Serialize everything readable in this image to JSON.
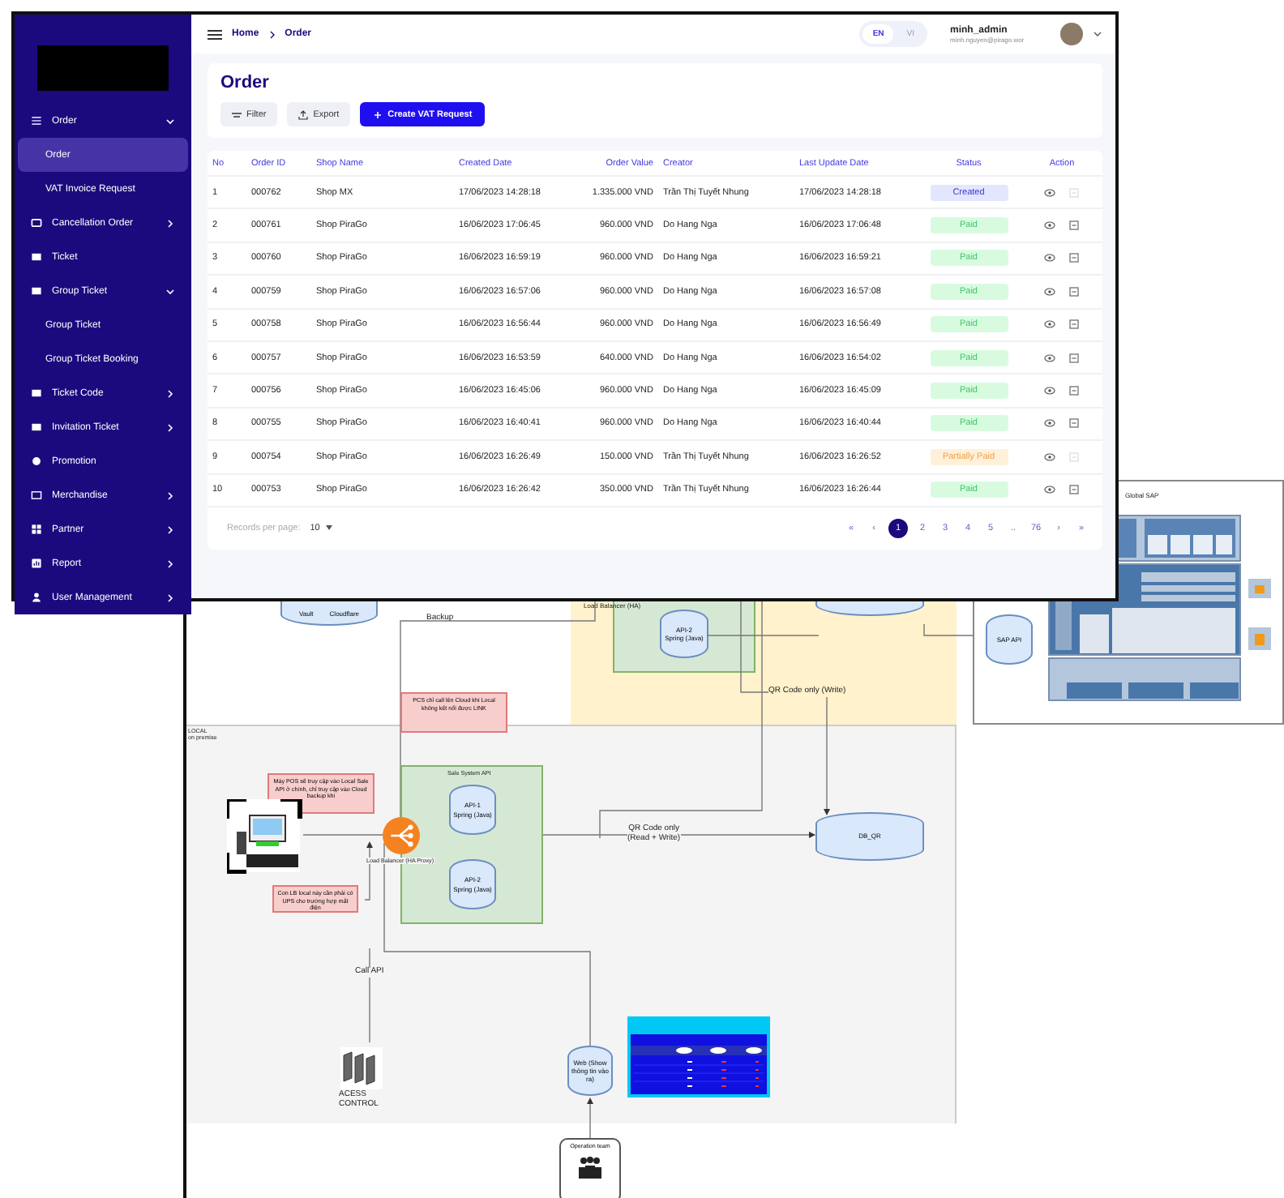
{
  "admin_window": {
    "sidebar": {
      "items": [
        {
          "label": "Order",
          "kind": "group",
          "expanded": true,
          "selected": false,
          "children": [
            {
              "label": "Order",
              "selected": true
            },
            {
              "label": "VAT Invoice Request",
              "selected": false
            }
          ]
        },
        {
          "label": "Cancellation Order",
          "kind": "group",
          "expanded": false,
          "selected": false
        },
        {
          "label": "Ticket",
          "kind": "link",
          "selected": false
        },
        {
          "label": "Group Ticket",
          "kind": "group",
          "expanded": true,
          "selected": false,
          "children": [
            {
              "label": "Group Ticket",
              "selected": false
            },
            {
              "label": "Group Ticket Booking",
              "selected": false
            }
          ]
        },
        {
          "label": "Ticket Code",
          "kind": "group",
          "expanded": false,
          "selected": false
        },
        {
          "label": "Invitation Ticket",
          "kind": "group",
          "expanded": false,
          "selected": false
        },
        {
          "label": "Promotion",
          "kind": "link",
          "selected": false
        },
        {
          "label": "Merchandise",
          "kind": "group",
          "expanded": false,
          "selected": false
        },
        {
          "label": "Partner",
          "kind": "group",
          "expanded": false,
          "selected": false
        },
        {
          "label": "Report",
          "kind": "group",
          "expanded": false,
          "selected": false
        },
        {
          "label": "User Management",
          "kind": "group",
          "expanded": false,
          "selected": false
        }
      ]
    },
    "breadcrumb": [
      "Home",
      "Order"
    ],
    "languages": [
      {
        "label": "EN",
        "selected": true
      },
      {
        "label": "VI",
        "selected": false
      }
    ],
    "user": {
      "name": "minh_admin",
      "email": "minh.nguyen@pirago.wor"
    },
    "page_title": "Order",
    "toolbar": [
      {
        "label": "Filter",
        "kind": "filter"
      },
      {
        "label": "Export",
        "kind": "export"
      },
      {
        "label": "Create VAT Request",
        "kind": "primary"
      }
    ],
    "table": {
      "columns": [
        "No",
        "Order ID",
        "Shop Name",
        "Created Date",
        "Order Value",
        "Creator",
        "Last Update Date",
        "Status",
        "Action"
      ],
      "rows": [
        {
          "no": "1",
          "order_id": "000762",
          "shop": "Shop MX",
          "created": "17/06/2023 14:28:18",
          "value": "1.335.000 VND",
          "creator": "Trần Thị Tuyết Nhung",
          "updated": "17/06/2023 14:28:18",
          "status": "Created",
          "kind": "created",
          "invoice_disabled": true
        },
        {
          "no": "2",
          "order_id": "000761",
          "shop": "Shop PiraGo",
          "created": "16/06/2023 17:06:45",
          "value": "960.000 VND",
          "creator": "Do Hang Nga",
          "updated": "16/06/2023 17:06:48",
          "status": "Paid",
          "kind": "paid",
          "invoice_disabled": false
        },
        {
          "no": "3",
          "order_id": "000760",
          "shop": "Shop PiraGo",
          "created": "16/06/2023 16:59:19",
          "value": "960.000 VND",
          "creator": "Do Hang Nga",
          "updated": "16/06/2023 16:59:21",
          "status": "Paid",
          "kind": "paid",
          "invoice_disabled": false
        },
        {
          "no": "4",
          "order_id": "000759",
          "shop": "Shop PiraGo",
          "created": "16/06/2023 16:57:06",
          "value": "960.000 VND",
          "creator": "Do Hang Nga",
          "updated": "16/06/2023 16:57:08",
          "status": "Paid",
          "kind": "paid",
          "invoice_disabled": false
        },
        {
          "no": "5",
          "order_id": "000758",
          "shop": "Shop PiraGo",
          "created": "16/06/2023 16:56:44",
          "value": "960.000 VND",
          "creator": "Do Hang Nga",
          "updated": "16/06/2023 16:56:49",
          "status": "Paid",
          "kind": "paid",
          "invoice_disabled": false
        },
        {
          "no": "6",
          "order_id": "000757",
          "shop": "Shop PiraGo",
          "created": "16/06/2023 16:53:59",
          "value": "640.000 VND",
          "creator": "Do Hang Nga",
          "updated": "16/06/2023 16:54:02",
          "status": "Paid",
          "kind": "paid",
          "invoice_disabled": false
        },
        {
          "no": "7",
          "order_id": "000756",
          "shop": "Shop PiraGo",
          "created": "16/06/2023 16:45:06",
          "value": "960.000 VND",
          "creator": "Do Hang Nga",
          "updated": "16/06/2023 16:45:09",
          "status": "Paid",
          "kind": "paid",
          "invoice_disabled": false
        },
        {
          "no": "8",
          "order_id": "000755",
          "shop": "Shop PiraGo",
          "created": "16/06/2023 16:40:41",
          "value": "960.000 VND",
          "creator": "Do Hang Nga",
          "updated": "16/06/2023 16:40:44",
          "status": "Paid",
          "kind": "paid",
          "invoice_disabled": false
        },
        {
          "no": "9",
          "order_id": "000754",
          "shop": "Shop PiraGo",
          "created": "16/06/2023 16:26:49",
          "value": "150.000 VND",
          "creator": "Trần Thị Tuyết Nhung",
          "updated": "16/06/2023 16:26:52",
          "status": "Partially Paid",
          "kind": "partial",
          "invoice_disabled": true
        },
        {
          "no": "10",
          "order_id": "000753",
          "shop": "Shop PiraGo",
          "created": "16/06/2023 16:26:42",
          "value": "350.000 VND",
          "creator": "Trần Thị Tuyết Nhung",
          "updated": "16/06/2023 16:26:44",
          "status": "Paid",
          "kind": "paid",
          "invoice_disabled": false
        }
      ]
    },
    "records_per_page": {
      "label": "Records per page:",
      "value": "10"
    },
    "pagination": [
      {
        "label": "«",
        "selected": false
      },
      {
        "label": "‹",
        "selected": false
      },
      {
        "label": "1",
        "selected": true
      },
      {
        "label": "2",
        "selected": false
      },
      {
        "label": "3",
        "selected": false
      },
      {
        "label": "4",
        "selected": false
      },
      {
        "label": "5",
        "selected": false
      },
      {
        "label": "..",
        "selected": false
      },
      {
        "label": "76",
        "selected": false
      },
      {
        "label": "›",
        "selected": false
      },
      {
        "label": "»",
        "selected": false
      }
    ]
  },
  "diagram": {
    "cloud_services": [
      "Vault",
      "Cloudflare"
    ],
    "cloud_load_balancer": "Load Balancer (HA)",
    "cloud_api": {
      "name": "API-2",
      "tech": "Spring (Java)"
    },
    "backup_edge": "Backup",
    "qr_write_edge": "QR Code only (Write)",
    "zone": {
      "name": "LOCAL",
      "subtitle": "on premise"
    },
    "notes": [
      "PCS chỉ call lên Cloud khi Local không kết nối được LINK",
      "Máy POS sẽ truy cập vào Local Sale API ở chính, chỉ truy cập vào Cloud backup khi",
      "Con LB local này cần phải có UPS cho trường hợp mất điện"
    ],
    "sale_group": "Sale System API",
    "apis": [
      {
        "name": "API-1",
        "tech": "Spring (Java)"
      },
      {
        "name": "API-2",
        "tech": "Spring (Java)"
      }
    ],
    "local_load_balancer": "Load Balancer (HA Proxy)",
    "qr_rw_edge": [
      "QR Code only",
      "(Read + Write)"
    ],
    "db_qr": "DB_QR",
    "call_api_edge": "Call API",
    "access_control": [
      "ACESS",
      "CONTROL"
    ],
    "web_db": "Web (Show thông tin vào ra)",
    "operation_team": "Operation team",
    "sap_window": {
      "title": "Global SAP",
      "api": "SAP API"
    }
  }
}
